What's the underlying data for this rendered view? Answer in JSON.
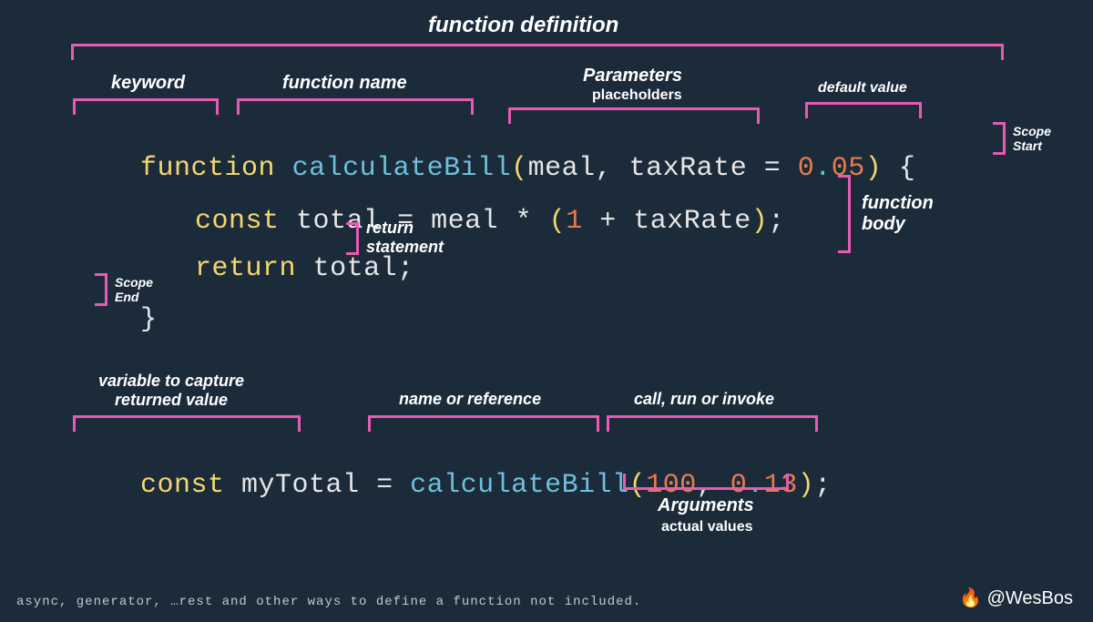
{
  "labels": {
    "function_definition": "function definition",
    "keyword": "keyword",
    "function_name": "function name",
    "parameters": "Parameters",
    "parameters_sub": "placeholders",
    "default_value": "default value",
    "scope_start": "Scope\nStart",
    "function_body": "function\nbody",
    "return_statement": "return\nstatement",
    "scope_end": "Scope\nEnd",
    "variable_capture": "variable to capture\nreturned value",
    "name_reference": "name or reference",
    "call_invoke": "call, run or invoke",
    "arguments": "Arguments",
    "arguments_sub": "actual values"
  },
  "code": {
    "line1": {
      "keyword": "function",
      "name": "calculateBill",
      "paren_open": "(",
      "param1": "meal",
      "comma1": ",",
      "param2": "taxRate",
      "eq": "=",
      "default_int": "0",
      "default_dot": ".",
      "default_frac": "05",
      "paren_close": ")",
      "brace_open": "{"
    },
    "line2": {
      "const": "const",
      "total": "total",
      "eq": "=",
      "meal": "meal",
      "star": "*",
      "paren_open": "(",
      "one": "1",
      "plus": "+",
      "taxRate": "taxRate",
      "paren_close": ")",
      "semi": ";"
    },
    "line3": {
      "return": "return",
      "total": "total",
      "semi": ";"
    },
    "line4": {
      "brace_close": "}"
    },
    "call": {
      "const": "const",
      "var": "myTotal",
      "eq": "=",
      "fn": "calculateBill",
      "paren_open": "(",
      "arg1": "100",
      "comma": ",",
      "arg2_int": "0",
      "arg2_dot": ".",
      "arg2_frac": "13",
      "paren_close": ")",
      "semi": ";"
    }
  },
  "footer": "async, generator, …rest and other ways to define a function not included.",
  "credit": "@WesBos",
  "fire_icon": "🔥"
}
